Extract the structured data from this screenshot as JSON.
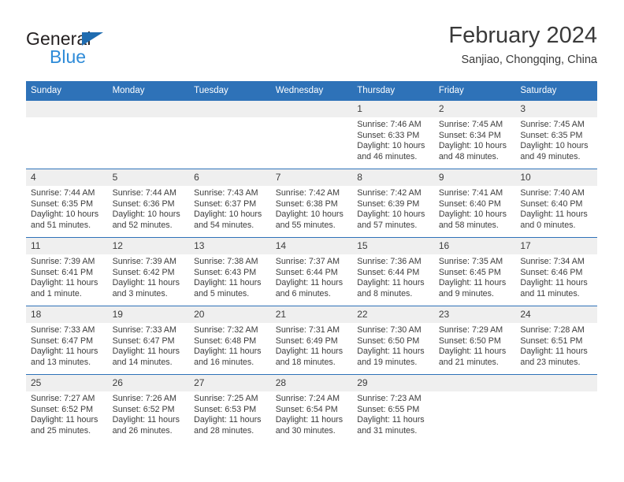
{
  "brand": {
    "name_part1": "General",
    "name_part2": "Blue",
    "triangle_color": "#1f6cb0",
    "blue_color": "#2e8bd8"
  },
  "header": {
    "month_title": "February 2024",
    "location": "Sanjiao, Chongqing, China"
  },
  "theme": {
    "header_blue": "#2e72b8",
    "daynum_band": "#efefef",
    "text_color": "#3c3c3c"
  },
  "calendar": {
    "weekday_headers": [
      "Sunday",
      "Monday",
      "Tuesday",
      "Wednesday",
      "Thursday",
      "Friday",
      "Saturday"
    ],
    "weeks": [
      [
        {
          "day": "",
          "lines": []
        },
        {
          "day": "",
          "lines": []
        },
        {
          "day": "",
          "lines": []
        },
        {
          "day": "",
          "lines": []
        },
        {
          "day": "1",
          "lines": [
            "Sunrise: 7:46 AM",
            "Sunset: 6:33 PM",
            "Daylight: 10 hours",
            "and 46 minutes."
          ]
        },
        {
          "day": "2",
          "lines": [
            "Sunrise: 7:45 AM",
            "Sunset: 6:34 PM",
            "Daylight: 10 hours",
            "and 48 minutes."
          ]
        },
        {
          "day": "3",
          "lines": [
            "Sunrise: 7:45 AM",
            "Sunset: 6:35 PM",
            "Daylight: 10 hours",
            "and 49 minutes."
          ]
        }
      ],
      [
        {
          "day": "4",
          "lines": [
            "Sunrise: 7:44 AM",
            "Sunset: 6:35 PM",
            "Daylight: 10 hours",
            "and 51 minutes."
          ]
        },
        {
          "day": "5",
          "lines": [
            "Sunrise: 7:44 AM",
            "Sunset: 6:36 PM",
            "Daylight: 10 hours",
            "and 52 minutes."
          ]
        },
        {
          "day": "6",
          "lines": [
            "Sunrise: 7:43 AM",
            "Sunset: 6:37 PM",
            "Daylight: 10 hours",
            "and 54 minutes."
          ]
        },
        {
          "day": "7",
          "lines": [
            "Sunrise: 7:42 AM",
            "Sunset: 6:38 PM",
            "Daylight: 10 hours",
            "and 55 minutes."
          ]
        },
        {
          "day": "8",
          "lines": [
            "Sunrise: 7:42 AM",
            "Sunset: 6:39 PM",
            "Daylight: 10 hours",
            "and 57 minutes."
          ]
        },
        {
          "day": "9",
          "lines": [
            "Sunrise: 7:41 AM",
            "Sunset: 6:40 PM",
            "Daylight: 10 hours",
            "and 58 minutes."
          ]
        },
        {
          "day": "10",
          "lines": [
            "Sunrise: 7:40 AM",
            "Sunset: 6:40 PM",
            "Daylight: 11 hours",
            "and 0 minutes."
          ]
        }
      ],
      [
        {
          "day": "11",
          "lines": [
            "Sunrise: 7:39 AM",
            "Sunset: 6:41 PM",
            "Daylight: 11 hours",
            "and 1 minute."
          ]
        },
        {
          "day": "12",
          "lines": [
            "Sunrise: 7:39 AM",
            "Sunset: 6:42 PM",
            "Daylight: 11 hours",
            "and 3 minutes."
          ]
        },
        {
          "day": "13",
          "lines": [
            "Sunrise: 7:38 AM",
            "Sunset: 6:43 PM",
            "Daylight: 11 hours",
            "and 5 minutes."
          ]
        },
        {
          "day": "14",
          "lines": [
            "Sunrise: 7:37 AM",
            "Sunset: 6:44 PM",
            "Daylight: 11 hours",
            "and 6 minutes."
          ]
        },
        {
          "day": "15",
          "lines": [
            "Sunrise: 7:36 AM",
            "Sunset: 6:44 PM",
            "Daylight: 11 hours",
            "and 8 minutes."
          ]
        },
        {
          "day": "16",
          "lines": [
            "Sunrise: 7:35 AM",
            "Sunset: 6:45 PM",
            "Daylight: 11 hours",
            "and 9 minutes."
          ]
        },
        {
          "day": "17",
          "lines": [
            "Sunrise: 7:34 AM",
            "Sunset: 6:46 PM",
            "Daylight: 11 hours",
            "and 11 minutes."
          ]
        }
      ],
      [
        {
          "day": "18",
          "lines": [
            "Sunrise: 7:33 AM",
            "Sunset: 6:47 PM",
            "Daylight: 11 hours",
            "and 13 minutes."
          ]
        },
        {
          "day": "19",
          "lines": [
            "Sunrise: 7:33 AM",
            "Sunset: 6:47 PM",
            "Daylight: 11 hours",
            "and 14 minutes."
          ]
        },
        {
          "day": "20",
          "lines": [
            "Sunrise: 7:32 AM",
            "Sunset: 6:48 PM",
            "Daylight: 11 hours",
            "and 16 minutes."
          ]
        },
        {
          "day": "21",
          "lines": [
            "Sunrise: 7:31 AM",
            "Sunset: 6:49 PM",
            "Daylight: 11 hours",
            "and 18 minutes."
          ]
        },
        {
          "day": "22",
          "lines": [
            "Sunrise: 7:30 AM",
            "Sunset: 6:50 PM",
            "Daylight: 11 hours",
            "and 19 minutes."
          ]
        },
        {
          "day": "23",
          "lines": [
            "Sunrise: 7:29 AM",
            "Sunset: 6:50 PM",
            "Daylight: 11 hours",
            "and 21 minutes."
          ]
        },
        {
          "day": "24",
          "lines": [
            "Sunrise: 7:28 AM",
            "Sunset: 6:51 PM",
            "Daylight: 11 hours",
            "and 23 minutes."
          ]
        }
      ],
      [
        {
          "day": "25",
          "lines": [
            "Sunrise: 7:27 AM",
            "Sunset: 6:52 PM",
            "Daylight: 11 hours",
            "and 25 minutes."
          ]
        },
        {
          "day": "26",
          "lines": [
            "Sunrise: 7:26 AM",
            "Sunset: 6:52 PM",
            "Daylight: 11 hours",
            "and 26 minutes."
          ]
        },
        {
          "day": "27",
          "lines": [
            "Sunrise: 7:25 AM",
            "Sunset: 6:53 PM",
            "Daylight: 11 hours",
            "and 28 minutes."
          ]
        },
        {
          "day": "28",
          "lines": [
            "Sunrise: 7:24 AM",
            "Sunset: 6:54 PM",
            "Daylight: 11 hours",
            "and 30 minutes."
          ]
        },
        {
          "day": "29",
          "lines": [
            "Sunrise: 7:23 AM",
            "Sunset: 6:55 PM",
            "Daylight: 11 hours",
            "and 31 minutes."
          ]
        },
        {
          "day": "",
          "lines": []
        },
        {
          "day": "",
          "lines": []
        }
      ]
    ]
  }
}
